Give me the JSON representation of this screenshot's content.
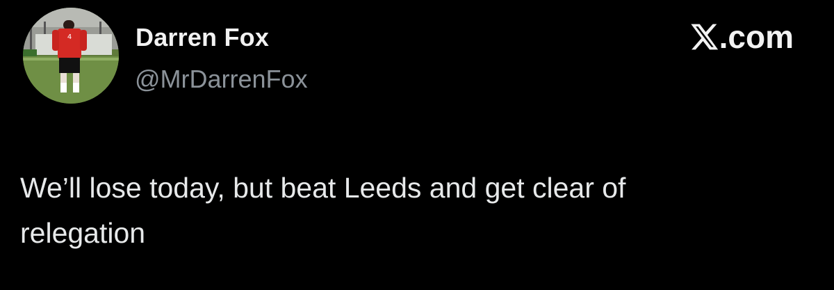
{
  "author": {
    "display_name": "Darren Fox",
    "handle": "@MrDarrenFox",
    "avatar": "profile-photo"
  },
  "brand": {
    "icon": "x-logo-icon",
    "domain_suffix": ".com"
  },
  "tweet": {
    "text": "We’ll lose today, but beat Leeds and get clear of\nrelegation"
  },
  "colors": {
    "background": "#000000",
    "name": "#f2f2f2",
    "handle": "#8b9299",
    "text": "#e7e9ea"
  }
}
